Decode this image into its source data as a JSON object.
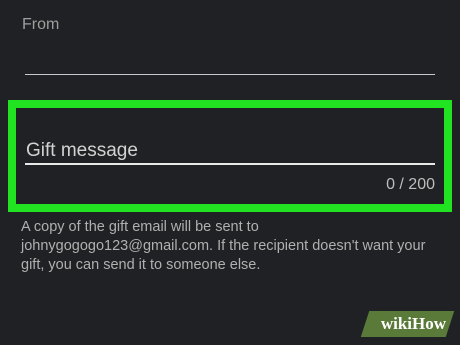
{
  "form": {
    "from_label": "From",
    "gift_message_placeholder": "Gift message",
    "gift_message_value": "",
    "char_counter": "0 / 200",
    "helper_text": "A copy of the gift email will be sent to johnygogogo123@gmail.com. If the recipient doesn't want your gift, you can send it to someone else."
  },
  "watermark": {
    "wiki": "wiki",
    "how": "How"
  },
  "colors": {
    "background": "#202124",
    "highlight": "#22e322",
    "underline": "#e8e8e8",
    "watermark_bg": "#5a7a3a"
  }
}
